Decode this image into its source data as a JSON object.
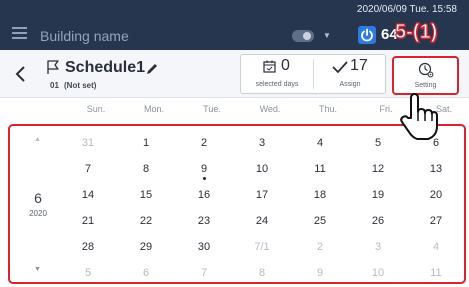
{
  "topbar": {
    "building_name": "Building name",
    "datetime": "2020/06/09 Tue. 15:58",
    "temperature": "64",
    "power_state": "on"
  },
  "header": {
    "schedule_name": "Schedule1",
    "schedule_number": "01",
    "schedule_subtitle": "(Not set)",
    "selected_days_count": "0",
    "selected_days_label": "selected days",
    "assign_count": "17",
    "assign_label": "Assign",
    "setting_label": "Setting"
  },
  "annotation": "5-(1)",
  "weekdays": [
    "Sun.",
    "Mon.",
    "Tue.",
    "Wed.",
    "Thu.",
    "Fri.",
    "Sat."
  ],
  "calendar": {
    "month": "6",
    "year": "2020",
    "weeks": [
      [
        {
          "d": "31",
          "o": true
        },
        {
          "d": "1"
        },
        {
          "d": "2"
        },
        {
          "d": "3"
        },
        {
          "d": "4"
        },
        {
          "d": "5"
        },
        {
          "d": "6"
        }
      ],
      [
        {
          "d": "7"
        },
        {
          "d": "8"
        },
        {
          "d": "9",
          "today": true
        },
        {
          "d": "10"
        },
        {
          "d": "11"
        },
        {
          "d": "12"
        },
        {
          "d": "13"
        }
      ],
      [
        {
          "d": "14"
        },
        {
          "d": "15"
        },
        {
          "d": "16"
        },
        {
          "d": "17"
        },
        {
          "d": "18"
        },
        {
          "d": "19"
        },
        {
          "d": "20"
        }
      ],
      [
        {
          "d": "21"
        },
        {
          "d": "22"
        },
        {
          "d": "23"
        },
        {
          "d": "24"
        },
        {
          "d": "25"
        },
        {
          "d": "26"
        },
        {
          "d": "27"
        }
      ],
      [
        {
          "d": "28"
        },
        {
          "d": "29"
        },
        {
          "d": "30"
        },
        {
          "d": "7/1",
          "o": true
        },
        {
          "d": "2",
          "o": true
        },
        {
          "d": "3",
          "o": true
        },
        {
          "d": "4",
          "o": true
        }
      ],
      [
        {
          "d": "5",
          "o": true
        },
        {
          "d": "6",
          "o": true
        },
        {
          "d": "7",
          "o": true
        },
        {
          "d": "8",
          "o": true
        },
        {
          "d": "9",
          "o": true
        },
        {
          "d": "10",
          "o": true
        },
        {
          "d": "11",
          "o": true
        }
      ]
    ]
  },
  "colors": {
    "topbar_bg": "#26364f",
    "highlight_red": "#d9232e",
    "power_blue": "#2d7be0",
    "muted_day": "#b5bbc5"
  },
  "icons": [
    "menu-icon",
    "toggle-icon",
    "power-icon",
    "back-icon",
    "flag-icon",
    "pencil-icon",
    "calendar-icon",
    "check-icon",
    "clock-gear-icon",
    "hand-pointer-icon"
  ]
}
